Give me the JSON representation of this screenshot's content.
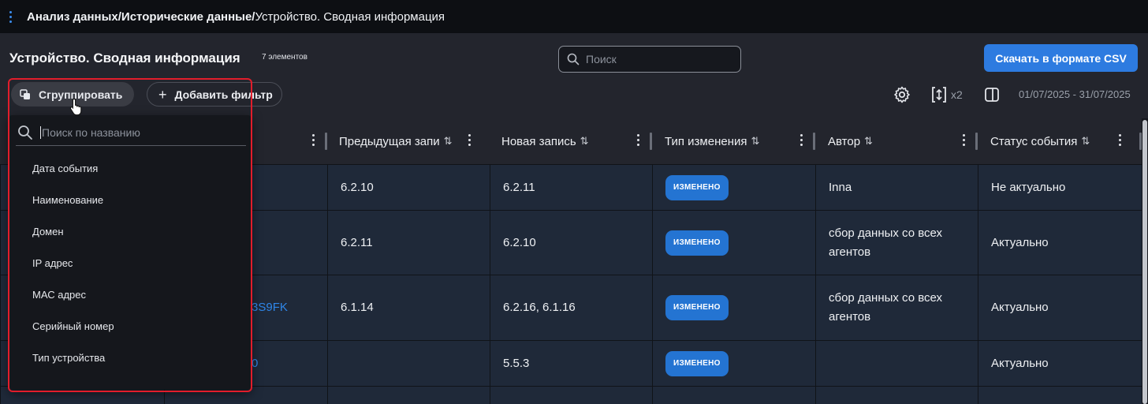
{
  "breadcrumb": {
    "part1": "Анализ данных/",
    "part2": "Исторические данные/",
    "part3": "Устройство. Сводная информация"
  },
  "header": {
    "title": "Устройство. Сводная информация",
    "count": "7 элементов",
    "search_placeholder": "Поиск",
    "csv_button": "Скачать в формате CSV",
    "group_button": "Сгруппировать",
    "filter_button": "Добавить фильтр",
    "density_label": "x2",
    "date_range": "01/07/2025 - 31/07/2025"
  },
  "icons": [
    "menu-dots-icon",
    "search-icon",
    "group-icon",
    "plus-icon",
    "gear-icon",
    "density-icon",
    "panel-icon",
    "sort-icon",
    "column-menu-icon",
    "pointer-cursor-icon"
  ],
  "colors": {
    "accent": "#2d7be0",
    "badge": "#2474d2",
    "link": "#2f86e8",
    "highlight": "#e21d2b"
  },
  "table": {
    "columns": [
      {
        "label": "ие",
        "sortable": true
      },
      {
        "label": "Предыдущая запи",
        "sortable": true
      },
      {
        "label": "Новая запись",
        "sortable": true
      },
      {
        "label": "Тип изменения",
        "sortable": true
      },
      {
        "label": "Автор",
        "sortable": true
      },
      {
        "label": "Статус события",
        "sortable": true
      }
    ],
    "sort_symbol": "⇅",
    "rows": [
      {
        "name": "",
        "prev": "6.2.10",
        "new": "6.2.11",
        "type": "ИЗМЕНЕНО",
        "author": "Inna",
        "status": "Не актуально"
      },
      {
        "name": "",
        "prev": "6.2.11",
        "new": "6.2.10",
        "type": "ИЗМЕНЕНО",
        "author": "сбор данных со всех агентов",
        "status": "Актуально"
      },
      {
        "name": "3S9FK",
        "prev": "6.1.14",
        "new": "6.2.16, 6.1.16",
        "type": "ИЗМЕНЕНО",
        "author": "сбор данных со всех агентов",
        "status": "Актуально"
      },
      {
        "name": "0",
        "prev": "",
        "new": "5.5.3",
        "type": "ИЗМЕНЕНО",
        "author": "",
        "status": "Актуально"
      },
      {
        "name": "",
        "prev": "",
        "new": "",
        "type": "",
        "author": "",
        "status": ""
      }
    ]
  },
  "dropdown": {
    "search_placeholder": "Поиск по названию",
    "items": [
      "Дата события",
      "Наименование",
      "Домен",
      "IP адрес",
      "МАС адрес",
      "Серийный номер",
      "Тип устройства"
    ]
  }
}
